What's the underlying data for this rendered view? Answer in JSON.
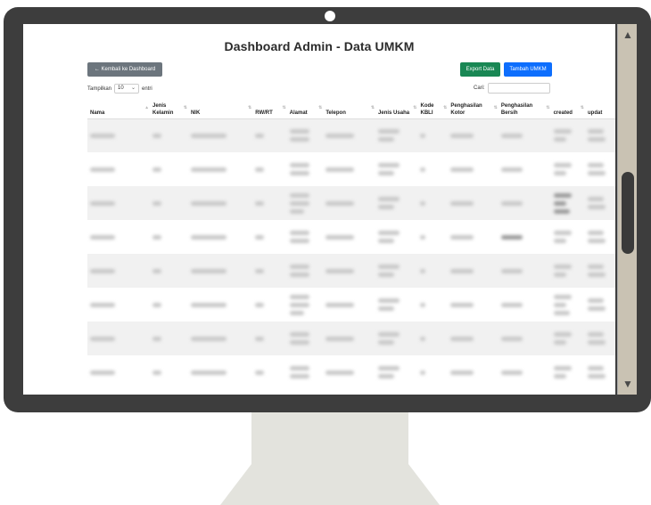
{
  "page": {
    "title": "Dashboard Admin - Data UMKM",
    "back_button": "← Kembali ke Dashboard",
    "export_button": "Export Data",
    "add_button": "Tambah UMKM",
    "length_prefix": "Tampilkan",
    "length_value": "10",
    "length_suffix": "entri",
    "search_label": "Cari:"
  },
  "table": {
    "headers": [
      "Nama",
      "Jenis Kelamin",
      "NIK",
      "RW/RT",
      "Alamat",
      "Telepon",
      "Jenis Usaha",
      "Kode KBLI",
      "Penghasilan Kotor",
      "Penghasilan Bersih",
      "created",
      "updat"
    ]
  },
  "colors": {
    "bezel": "#3d3d3d",
    "stand": "#e3e3dd",
    "export": "#198754",
    "add": "#0d6efd",
    "back": "#6c757d"
  },
  "icons": [
    "camera-dot",
    "scroll-up-arrow",
    "scroll-down-arrow",
    "select-chevron"
  ]
}
